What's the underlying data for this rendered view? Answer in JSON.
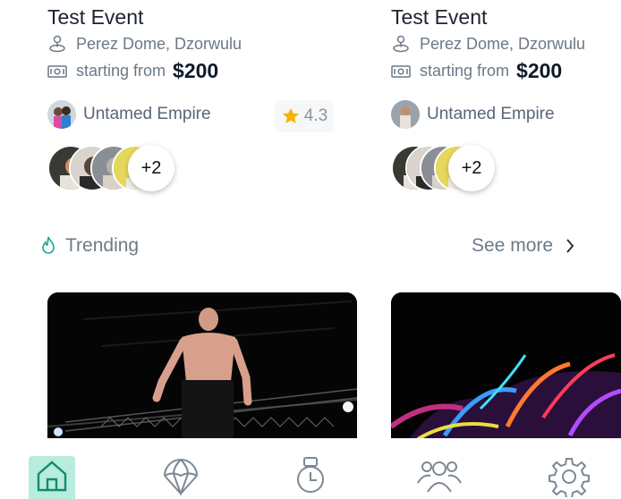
{
  "events": [
    {
      "title": "Test Event",
      "venue": "Perez Dome, Dzorwulu",
      "price_prefix": "starting from",
      "price": "$200",
      "host": "Untamed Empire",
      "rating": "4.3",
      "attendees_more": "+2"
    },
    {
      "title": "Test Event",
      "venue": "Perez Dome, Dzorwulu",
      "price_prefix": "starting from",
      "price": "$200",
      "host": "Untamed Empire",
      "attendees_more": "+2"
    }
  ],
  "trending": {
    "label": "Trending",
    "see_more": "See more"
  },
  "nav": {
    "items": [
      {
        "icon": "home-icon",
        "active": true
      },
      {
        "icon": "parachute-icon",
        "active": false
      },
      {
        "icon": "watch-icon",
        "active": false
      },
      {
        "icon": "people-icon",
        "active": false
      },
      {
        "icon": "gear-icon",
        "active": false
      }
    ]
  },
  "colors": {
    "accent": "#1aa88a",
    "nav_active_bg": "#b8ecdc",
    "star": "#f5b301"
  }
}
